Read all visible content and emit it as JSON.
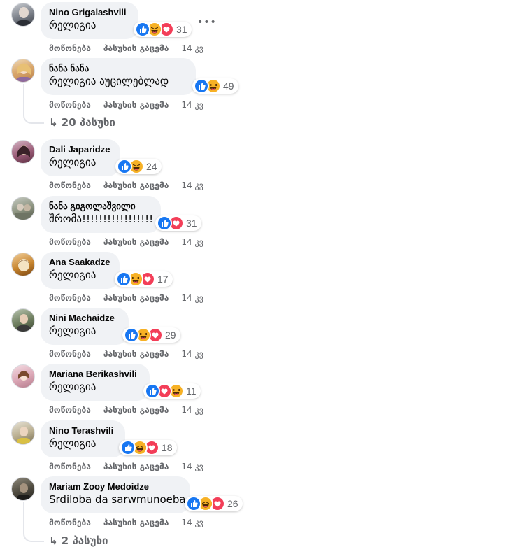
{
  "actions": {
    "like": "მოწონება",
    "reply": "პასუხის გაცემა"
  },
  "more_icon": "more-horizontal-icon",
  "reaction_colors": {
    "like": "#1877f2",
    "haha": "#f7b125",
    "love": "#f33e58"
  },
  "comments": [
    {
      "author": "Nino Grigalashvili",
      "text": "რელიგია",
      "reactions": [
        "like",
        "haha",
        "love"
      ],
      "count": "31",
      "time": "14 კვ"
    },
    {
      "author": "ნანა ნანა",
      "text": "რელიგია აუცილებლად",
      "reactions": [
        "like",
        "haha"
      ],
      "count": "49",
      "time": "14 კვ",
      "replies": "↳ 20 პასუხი"
    },
    {
      "author": "Dali Japaridze",
      "text": "რელიგია",
      "reactions": [
        "like",
        "haha"
      ],
      "count": "24",
      "time": "14 კვ"
    },
    {
      "author": "ნანა გიგოლაშვილი",
      "text": "შრომა!!!!!!!!!!!!!!!!!",
      "reactions": [
        "like",
        "love"
      ],
      "count": "31",
      "time": "14 კვ"
    },
    {
      "author": "Ana Saakadze",
      "text": "რელიგია",
      "reactions": [
        "like",
        "haha",
        "love"
      ],
      "count": "17",
      "time": "14 კვ"
    },
    {
      "author": "Nini Machaidze",
      "text": "რელიგია",
      "reactions": [
        "like",
        "haha",
        "love"
      ],
      "count": "29",
      "time": "14 კვ"
    },
    {
      "author": "Mariana Berikashvili",
      "text": "რელიგია",
      "reactions": [
        "like",
        "love",
        "haha"
      ],
      "count": "11",
      "time": "14 კვ"
    },
    {
      "author": "Nino Terashvili",
      "text": "რელიგია",
      "reactions": [
        "like",
        "haha",
        "love"
      ],
      "count": "18",
      "time": "14 კვ"
    },
    {
      "author": "Mariam Zooy Medoidze",
      "text": "Srdiloba da sarwmunoeba",
      "reactions": [
        "like",
        "haha",
        "love"
      ],
      "count": "26",
      "time": "14 კვ",
      "replies": "↳ 2 პასუხი"
    }
  ]
}
